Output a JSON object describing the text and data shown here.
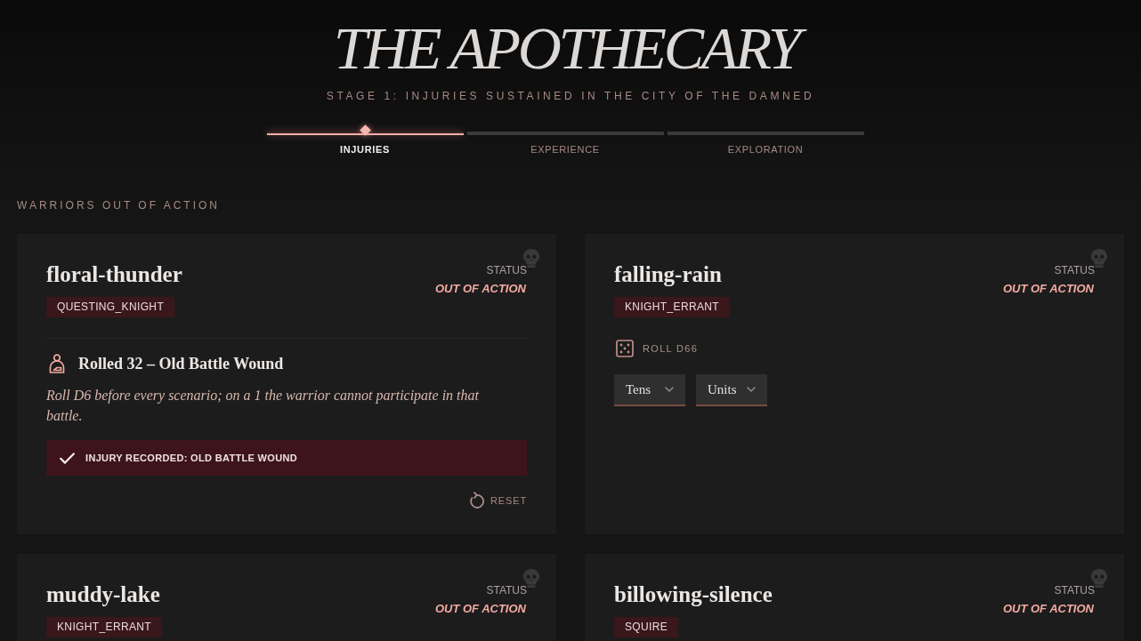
{
  "header": {
    "title": "THE APOTHECARY",
    "subtitle": "STAGE 1: INJURIES SUSTAINED IN THE CITY OF THE DAMNED"
  },
  "steps": [
    {
      "label": "INJURIES",
      "selected": true
    },
    {
      "label": "EXPERIENCE",
      "selected": false
    },
    {
      "label": "EXPLORATION",
      "selected": false
    }
  ],
  "section_label": "WARRIORS OUT OF ACTION",
  "warriors": [
    {
      "name": "floral-thunder",
      "tag": "QUESTING_KNIGHT",
      "status_label": "STATUS",
      "status": "OUT OF ACTION",
      "injury": {
        "title": "Rolled 32 – Old Battle Wound",
        "description": "Roll D6 before every scenario; on a 1 the warrior cannot participate in that battle.",
        "recorded": "INJURY RECORDED: OLD BATTLE WOUND",
        "reset": "RESET"
      }
    },
    {
      "name": "falling-rain",
      "tag": "KNIGHT_ERRANT",
      "status_label": "STATUS",
      "status": "OUT OF ACTION",
      "roll": {
        "label": "ROLL D66",
        "selects": [
          {
            "label": "Tens"
          },
          {
            "label": "Units"
          }
        ]
      }
    },
    {
      "name": "muddy-lake",
      "tag": "KNIGHT_ERRANT",
      "status_label": "STATUS",
      "status": "OUT OF ACTION"
    },
    {
      "name": "billowing-silence",
      "tag": "SQUIRE",
      "status_label": "STATUS",
      "status": "OUT OF ACTION"
    }
  ]
}
